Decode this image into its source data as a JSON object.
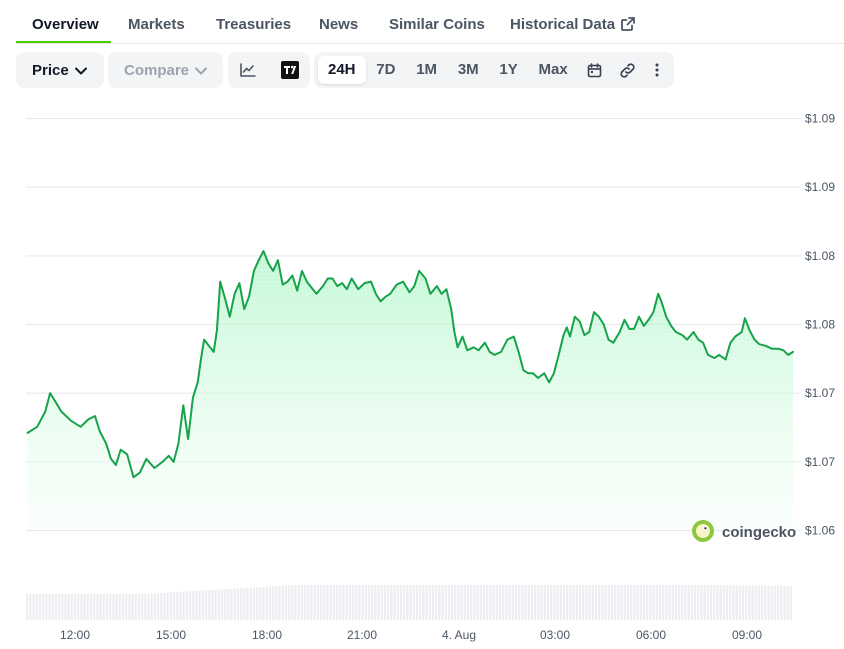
{
  "tabs": [
    {
      "label": "Overview",
      "active": true
    },
    {
      "label": "Markets"
    },
    {
      "label": "Treasuries"
    },
    {
      "label": "News"
    },
    {
      "label": "Similar Coins"
    },
    {
      "label": "Historical Data",
      "external": true
    }
  ],
  "toolbar": {
    "price_label": "Price",
    "compare_label": "Compare",
    "icons": [
      "line-chart-icon",
      "tradingview-icon",
      "calendar-icon",
      "link-icon",
      "more-icon"
    ],
    "ranges": [
      "24H",
      "7D",
      "1M",
      "3M",
      "1Y",
      "Max"
    ],
    "active_range": "24H"
  },
  "watermark": "coingecko",
  "colors": {
    "line": "#16a34a",
    "fill_top": "#bbf7d0",
    "accent": "#4bcc00",
    "grid": "#e5e7eb"
  },
  "chart_data": {
    "type": "area",
    "x_tick_labels": [
      "12:00",
      "15:00",
      "18:00",
      "21:00",
      "4. Aug",
      "03:00",
      "06:00",
      "09:00"
    ],
    "y_tick_labels": [
      "$1.09",
      "$1.09",
      "$1.08",
      "$1.08",
      "$1.07",
      "$1.07",
      "$1.06"
    ],
    "ylim": [
      1.0635,
      1.0915
    ],
    "xlim_hours": [
      10.0,
      33.9
    ],
    "grid": "horizontal",
    "volume_bars": true,
    "series": [
      {
        "points": [
          [
            10.05,
            1.0709
          ],
          [
            10.35,
            1.0713
          ],
          [
            10.6,
            1.0723
          ],
          [
            10.75,
            1.0735
          ],
          [
            10.9,
            1.073
          ],
          [
            11.1,
            1.0723
          ],
          [
            11.4,
            1.0717
          ],
          [
            11.7,
            1.0713
          ],
          [
            11.95,
            1.0718
          ],
          [
            12.15,
            1.072
          ],
          [
            12.3,
            1.071
          ],
          [
            12.5,
            1.0702
          ],
          [
            12.65,
            1.0692
          ],
          [
            12.8,
            1.0688
          ],
          [
            12.95,
            1.0698
          ],
          [
            13.15,
            1.0695
          ],
          [
            13.35,
            1.068
          ],
          [
            13.55,
            1.0683
          ],
          [
            13.75,
            1.0692
          ],
          [
            14.0,
            1.0686
          ],
          [
            14.25,
            1.069
          ],
          [
            14.45,
            1.0694
          ],
          [
            14.6,
            1.069
          ],
          [
            14.75,
            1.0702
          ],
          [
            14.9,
            1.0727
          ],
          [
            15.05,
            1.0705
          ],
          [
            15.2,
            1.0732
          ],
          [
            15.35,
            1.0742
          ],
          [
            15.45,
            1.0757
          ],
          [
            15.55,
            1.077
          ],
          [
            15.7,
            1.0766
          ],
          [
            15.85,
            1.0762
          ],
          [
            15.95,
            1.0776
          ],
          [
            16.05,
            1.0808
          ],
          [
            16.2,
            1.0797
          ],
          [
            16.35,
            1.0785
          ],
          [
            16.5,
            1.08
          ],
          [
            16.65,
            1.0807
          ],
          [
            16.8,
            1.079
          ],
          [
            16.95,
            1.0798
          ],
          [
            17.1,
            1.0815
          ],
          [
            17.25,
            1.0822
          ],
          [
            17.4,
            1.0828
          ],
          [
            17.55,
            1.082
          ],
          [
            17.7,
            1.0815
          ],
          [
            17.85,
            1.0822
          ],
          [
            18.0,
            1.0806
          ],
          [
            18.15,
            1.0808
          ],
          [
            18.3,
            1.0812
          ],
          [
            18.45,
            1.0802
          ],
          [
            18.6,
            1.0815
          ],
          [
            18.75,
            1.0808
          ],
          [
            18.9,
            1.0804
          ],
          [
            19.05,
            1.08
          ],
          [
            19.25,
            1.0805
          ],
          [
            19.4,
            1.081
          ],
          [
            19.55,
            1.081
          ],
          [
            19.7,
            1.0805
          ],
          [
            19.85,
            1.0807
          ],
          [
            20.0,
            1.0803
          ],
          [
            20.15,
            1.081
          ],
          [
            20.35,
            1.0803
          ],
          [
            20.55,
            1.0807
          ],
          [
            20.75,
            1.0808
          ],
          [
            20.9,
            1.08
          ],
          [
            21.05,
            1.0795
          ],
          [
            21.2,
            1.0798
          ],
          [
            21.35,
            1.08
          ],
          [
            21.55,
            1.0806
          ],
          [
            21.75,
            1.0808
          ],
          [
            21.95,
            1.0801
          ],
          [
            22.1,
            1.0805
          ],
          [
            22.25,
            1.0815
          ],
          [
            22.45,
            1.081
          ],
          [
            22.6,
            1.08
          ],
          [
            22.8,
            1.0805
          ],
          [
            22.95,
            1.08
          ],
          [
            23.1,
            1.0803
          ],
          [
            23.25,
            1.079
          ],
          [
            23.35,
            1.0775
          ],
          [
            23.45,
            1.0765
          ],
          [
            23.6,
            1.0772
          ],
          [
            23.75,
            1.0763
          ],
          [
            23.95,
            1.0765
          ],
          [
            24.1,
            1.0763
          ],
          [
            24.3,
            1.0768
          ],
          [
            24.45,
            1.0762
          ],
          [
            24.6,
            1.076
          ],
          [
            24.8,
            1.0762
          ],
          [
            25.0,
            1.077
          ],
          [
            25.2,
            1.0772
          ],
          [
            25.35,
            1.0762
          ],
          [
            25.5,
            1.075
          ],
          [
            25.65,
            1.0748
          ],
          [
            25.8,
            1.0748
          ],
          [
            25.95,
            1.0745
          ],
          [
            26.15,
            1.0748
          ],
          [
            26.3,
            1.0742
          ],
          [
            26.45,
            1.0748
          ],
          [
            26.6,
            1.076
          ],
          [
            26.75,
            1.0773
          ],
          [
            26.85,
            1.0778
          ],
          [
            26.95,
            1.0772
          ],
          [
            27.1,
            1.0785
          ],
          [
            27.25,
            1.0782
          ],
          [
            27.4,
            1.0773
          ],
          [
            27.55,
            1.0775
          ],
          [
            27.7,
            1.0788
          ],
          [
            27.85,
            1.0785
          ],
          [
            28.0,
            1.078
          ],
          [
            28.15,
            1.077
          ],
          [
            28.3,
            1.0768
          ],
          [
            28.5,
            1.0775
          ],
          [
            28.65,
            1.0783
          ],
          [
            28.8,
            1.0777
          ],
          [
            28.95,
            1.0777
          ],
          [
            29.1,
            1.0785
          ],
          [
            29.25,
            1.0779
          ],
          [
            29.4,
            1.0783
          ],
          [
            29.55,
            1.0788
          ],
          [
            29.7,
            1.08
          ],
          [
            29.8,
            1.0795
          ],
          [
            29.95,
            1.0785
          ],
          [
            30.1,
            1.0779
          ],
          [
            30.25,
            1.0775
          ],
          [
            30.45,
            1.0773
          ],
          [
            30.6,
            1.077
          ],
          [
            30.8,
            1.0775
          ],
          [
            30.95,
            1.077
          ],
          [
            31.1,
            1.0768
          ],
          [
            31.25,
            1.076
          ],
          [
            31.45,
            1.0758
          ],
          [
            31.6,
            1.076
          ],
          [
            31.8,
            1.0757
          ],
          [
            31.95,
            1.0768
          ],
          [
            32.1,
            1.0772
          ],
          [
            32.3,
            1.0775
          ],
          [
            32.4,
            1.0784
          ],
          [
            32.55,
            1.0776
          ],
          [
            32.7,
            1.077
          ],
          [
            32.85,
            1.0767
          ],
          [
            33.05,
            1.0766
          ],
          [
            33.25,
            1.0764
          ],
          [
            33.45,
            1.0764
          ],
          [
            33.6,
            1.0763
          ],
          [
            33.75,
            1.076
          ],
          [
            33.9,
            1.0762
          ]
        ]
      }
    ]
  }
}
